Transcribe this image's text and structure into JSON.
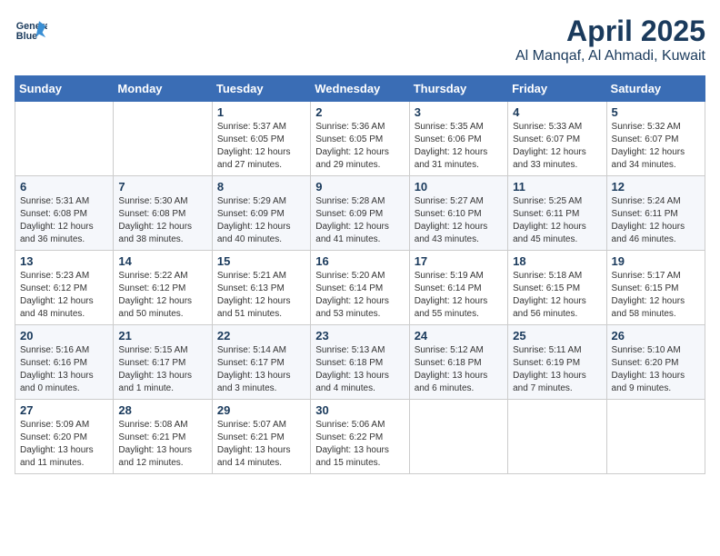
{
  "header": {
    "logo_line1": "General",
    "logo_line2": "Blue",
    "month": "April 2025",
    "location": "Al Manqaf, Al Ahmadi, Kuwait"
  },
  "days_of_week": [
    "Sunday",
    "Monday",
    "Tuesday",
    "Wednesday",
    "Thursday",
    "Friday",
    "Saturday"
  ],
  "weeks": [
    [
      {
        "day": null
      },
      {
        "day": null
      },
      {
        "day": "1",
        "sunrise": "5:37 AM",
        "sunset": "6:05 PM",
        "daylight": "12 hours and 27 minutes."
      },
      {
        "day": "2",
        "sunrise": "5:36 AM",
        "sunset": "6:05 PM",
        "daylight": "12 hours and 29 minutes."
      },
      {
        "day": "3",
        "sunrise": "5:35 AM",
        "sunset": "6:06 PM",
        "daylight": "12 hours and 31 minutes."
      },
      {
        "day": "4",
        "sunrise": "5:33 AM",
        "sunset": "6:07 PM",
        "daylight": "12 hours and 33 minutes."
      },
      {
        "day": "5",
        "sunrise": "5:32 AM",
        "sunset": "6:07 PM",
        "daylight": "12 hours and 34 minutes."
      }
    ],
    [
      {
        "day": "6",
        "sunrise": "5:31 AM",
        "sunset": "6:08 PM",
        "daylight": "12 hours and 36 minutes."
      },
      {
        "day": "7",
        "sunrise": "5:30 AM",
        "sunset": "6:08 PM",
        "daylight": "12 hours and 38 minutes."
      },
      {
        "day": "8",
        "sunrise": "5:29 AM",
        "sunset": "6:09 PM",
        "daylight": "12 hours and 40 minutes."
      },
      {
        "day": "9",
        "sunrise": "5:28 AM",
        "sunset": "6:09 PM",
        "daylight": "12 hours and 41 minutes."
      },
      {
        "day": "10",
        "sunrise": "5:27 AM",
        "sunset": "6:10 PM",
        "daylight": "12 hours and 43 minutes."
      },
      {
        "day": "11",
        "sunrise": "5:25 AM",
        "sunset": "6:11 PM",
        "daylight": "12 hours and 45 minutes."
      },
      {
        "day": "12",
        "sunrise": "5:24 AM",
        "sunset": "6:11 PM",
        "daylight": "12 hours and 46 minutes."
      }
    ],
    [
      {
        "day": "13",
        "sunrise": "5:23 AM",
        "sunset": "6:12 PM",
        "daylight": "12 hours and 48 minutes."
      },
      {
        "day": "14",
        "sunrise": "5:22 AM",
        "sunset": "6:12 PM",
        "daylight": "12 hours and 50 minutes."
      },
      {
        "day": "15",
        "sunrise": "5:21 AM",
        "sunset": "6:13 PM",
        "daylight": "12 hours and 51 minutes."
      },
      {
        "day": "16",
        "sunrise": "5:20 AM",
        "sunset": "6:14 PM",
        "daylight": "12 hours and 53 minutes."
      },
      {
        "day": "17",
        "sunrise": "5:19 AM",
        "sunset": "6:14 PM",
        "daylight": "12 hours and 55 minutes."
      },
      {
        "day": "18",
        "sunrise": "5:18 AM",
        "sunset": "6:15 PM",
        "daylight": "12 hours and 56 minutes."
      },
      {
        "day": "19",
        "sunrise": "5:17 AM",
        "sunset": "6:15 PM",
        "daylight": "12 hours and 58 minutes."
      }
    ],
    [
      {
        "day": "20",
        "sunrise": "5:16 AM",
        "sunset": "6:16 PM",
        "daylight": "13 hours and 0 minutes."
      },
      {
        "day": "21",
        "sunrise": "5:15 AM",
        "sunset": "6:17 PM",
        "daylight": "13 hours and 1 minute."
      },
      {
        "day": "22",
        "sunrise": "5:14 AM",
        "sunset": "6:17 PM",
        "daylight": "13 hours and 3 minutes."
      },
      {
        "day": "23",
        "sunrise": "5:13 AM",
        "sunset": "6:18 PM",
        "daylight": "13 hours and 4 minutes."
      },
      {
        "day": "24",
        "sunrise": "5:12 AM",
        "sunset": "6:18 PM",
        "daylight": "13 hours and 6 minutes."
      },
      {
        "day": "25",
        "sunrise": "5:11 AM",
        "sunset": "6:19 PM",
        "daylight": "13 hours and 7 minutes."
      },
      {
        "day": "26",
        "sunrise": "5:10 AM",
        "sunset": "6:20 PM",
        "daylight": "13 hours and 9 minutes."
      }
    ],
    [
      {
        "day": "27",
        "sunrise": "5:09 AM",
        "sunset": "6:20 PM",
        "daylight": "13 hours and 11 minutes."
      },
      {
        "day": "28",
        "sunrise": "5:08 AM",
        "sunset": "6:21 PM",
        "daylight": "13 hours and 12 minutes."
      },
      {
        "day": "29",
        "sunrise": "5:07 AM",
        "sunset": "6:21 PM",
        "daylight": "13 hours and 14 minutes."
      },
      {
        "day": "30",
        "sunrise": "5:06 AM",
        "sunset": "6:22 PM",
        "daylight": "13 hours and 15 minutes."
      },
      {
        "day": null
      },
      {
        "day": null
      },
      {
        "day": null
      }
    ]
  ],
  "labels": {
    "sunrise_prefix": "Sunrise: ",
    "sunset_prefix": "Sunset: ",
    "daylight_prefix": "Daylight: "
  }
}
